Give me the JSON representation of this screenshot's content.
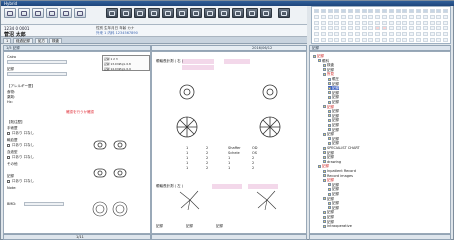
{
  "window": {
    "title": "Hybrid"
  },
  "patient": {
    "id": "1234 0 0001",
    "name": "菅沼 太郎",
    "info": "性別 生年月日 年齢 カナ",
    "info2": "外来 1 内科 1234567890"
  },
  "tabs": [
    {
      "label": "1"
    },
    {
      "label": "経過記録"
    },
    {
      "label": "処方"
    },
    {
      "label": "検査"
    }
  ],
  "left_panel": {
    "header": "1/5 記録",
    "labels": [
      "Cairo",
      "記録",
      "【アレルギー歴】",
      "食物:",
      "薬剤:",
      "Hx:",
      "【既往歴】",
      "手術歴",
      "口あり  口なし",
      "輸血歴",
      "口あり  口なし",
      "血液型",
      "口あり  口なし",
      "その他",
      "記録",
      "口あり  口なし",
      "Note:",
      "BMD:"
    ],
    "mini_table": [
      "記録 1  2  3",
      "記録 13.0mEq/L 0.8",
      "記録 14.0mEq/L 0.9"
    ],
    "red_note": "確認を行うか確認"
  },
  "mid_panel": {
    "toolbar_date": "2016/06/12",
    "labels": [
      "眼軸長計測 ( 右 )",
      "眼軸長計測 ( 左 )",
      "記録",
      "記録",
      "記録"
    ],
    "data_col1": [
      "1",
      "1",
      "1",
      "1",
      "1"
    ],
    "data_col2": [
      "2",
      "2",
      "2",
      "2",
      "2"
    ],
    "data_col3": [
      "Shaffer",
      "Scheie",
      "1",
      "1",
      "1"
    ],
    "data_col4": [
      "OD",
      "OS",
      "2",
      "2",
      "2"
    ]
  },
  "right_panel": {
    "header": "記録",
    "items": [
      {
        "label": "記録",
        "indent": 0,
        "style": "red"
      },
      {
        "label": "眼科",
        "indent": 1,
        "style": ""
      },
      {
        "label": "検査",
        "indent": 2,
        "style": ""
      },
      {
        "label": "記録",
        "indent": 2,
        "style": ""
      },
      {
        "label": "所見",
        "indent": 2,
        "style": "red"
      },
      {
        "label": "眼圧",
        "indent": 3,
        "style": ""
      },
      {
        "label": "記録",
        "indent": 3,
        "style": ""
      },
      {
        "label": "記録",
        "indent": 3,
        "style": "sel"
      },
      {
        "label": "記録",
        "indent": 3,
        "style": ""
      },
      {
        "label": "記録",
        "indent": 3,
        "style": ""
      },
      {
        "label": "記録",
        "indent": 3,
        "style": ""
      },
      {
        "label": "記録",
        "indent": 2,
        "style": "red"
      },
      {
        "label": "記録",
        "indent": 3,
        "style": ""
      },
      {
        "label": "記録",
        "indent": 3,
        "style": ""
      },
      {
        "label": "記録",
        "indent": 3,
        "style": ""
      },
      {
        "label": "記録",
        "indent": 3,
        "style": ""
      },
      {
        "label": "記録",
        "indent": 3,
        "style": ""
      },
      {
        "label": "記録",
        "indent": 2,
        "style": ""
      },
      {
        "label": "記録",
        "indent": 3,
        "style": ""
      },
      {
        "label": "記録",
        "indent": 3,
        "style": ""
      },
      {
        "label": "SPECIALIST CHART",
        "indent": 2,
        "style": ""
      },
      {
        "label": "記録",
        "indent": 2,
        "style": ""
      },
      {
        "label": "記録",
        "indent": 2,
        "style": ""
      },
      {
        "label": "drawing",
        "indent": 2,
        "style": ""
      },
      {
        "label": "記録",
        "indent": 1,
        "style": "red"
      },
      {
        "label": "Inpatient Record",
        "indent": 2,
        "style": ""
      },
      {
        "label": "Record images",
        "indent": 2,
        "style": ""
      },
      {
        "label": "記録",
        "indent": 2,
        "style": "red"
      },
      {
        "label": "記録",
        "indent": 3,
        "style": ""
      },
      {
        "label": "記録",
        "indent": 3,
        "style": ""
      },
      {
        "label": "記録",
        "indent": 3,
        "style": ""
      },
      {
        "label": "記録",
        "indent": 2,
        "style": ""
      },
      {
        "label": "記録",
        "indent": 3,
        "style": ""
      },
      {
        "label": "記録",
        "indent": 3,
        "style": ""
      },
      {
        "label": "記録",
        "indent": 2,
        "style": ""
      },
      {
        "label": "記録",
        "indent": 2,
        "style": ""
      },
      {
        "label": "記録",
        "indent": 2,
        "style": ""
      },
      {
        "label": "Intraoperative",
        "indent": 2,
        "style": ""
      }
    ]
  },
  "footer": {
    "page": "1/11"
  }
}
